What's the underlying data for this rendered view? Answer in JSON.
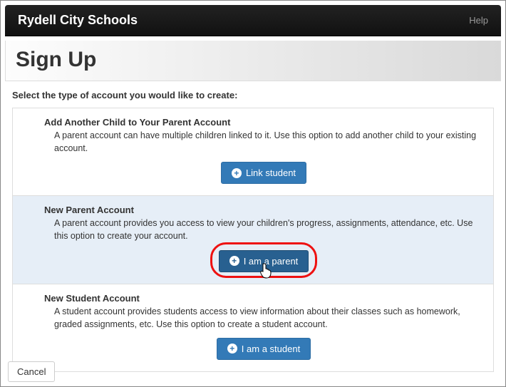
{
  "navbar": {
    "brand": "Rydell City Schools",
    "help": "Help"
  },
  "page": {
    "title": "Sign Up",
    "prompt": "Select the type of account you would like to create:"
  },
  "options": [
    {
      "title": "Add Another Child to Your Parent Account",
      "desc": "A parent account can have multiple children linked to it. Use this option to add another child to your existing account.",
      "button": "Link student"
    },
    {
      "title": "New Parent Account",
      "desc": "A parent account provides you access to view your children's progress, assignments, attendance, etc. Use this option to create your account.",
      "button": "I am a parent"
    },
    {
      "title": "New Student Account",
      "desc": "A student account provides students access to view information about their classes such as homework, graded assignments, etc. Use this option to create a student account.",
      "button": "I am a student"
    }
  ],
  "footer": {
    "cancel": "Cancel"
  },
  "colors": {
    "primary": "#337ab7",
    "highlight_bg": "#e6eef7",
    "annotation_ring": "#e11"
  }
}
